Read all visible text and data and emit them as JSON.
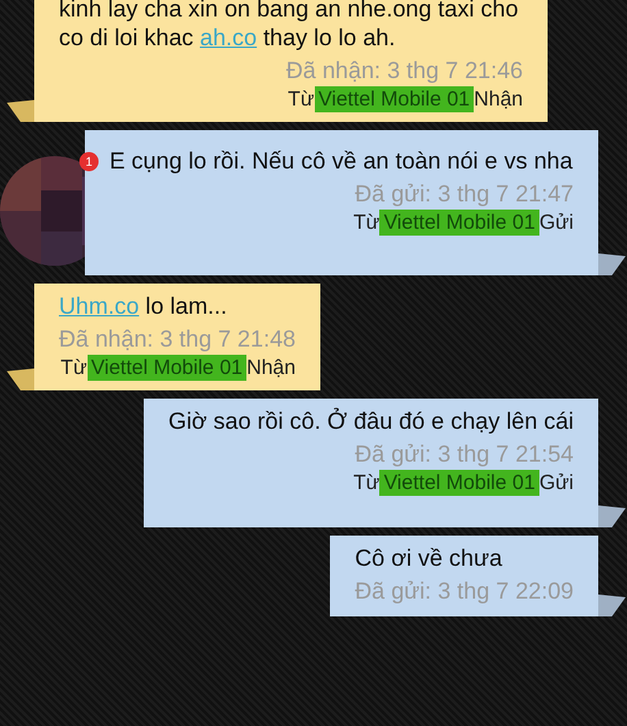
{
  "messages": [
    {
      "kind": "received",
      "parts": [
        {
          "kind": "text",
          "text": "kinh lay cha xin on bang an nhe.ong taxi cho co di loi khac "
        },
        {
          "kind": "link",
          "text": "ah.co"
        },
        {
          "kind": "text",
          "text": " thay lo lo ah."
        }
      ],
      "status": "Đã nhận: 3 thg 7 21:46",
      "from": {
        "prefix": "Từ",
        "sim": "Viettel Mobile 01",
        "direction": "Nhận"
      }
    },
    {
      "kind": "sent",
      "avatar": {
        "badge": "1"
      },
      "parts": [
        {
          "kind": "text",
          "text": "E cụng lo rồi. Nếu cô về an toàn nói e vs nha"
        }
      ],
      "status": "Đã gửi: 3 thg 7 21:47",
      "from": {
        "prefix": "Từ",
        "sim": "Viettel Mobile 01",
        "direction": "Gửi"
      }
    },
    {
      "kind": "received",
      "parts": [
        {
          "kind": "link",
          "text": "Uhm.co"
        },
        {
          "kind": "text",
          "text": " lo lam..."
        }
      ],
      "status": "Đã nhận: 3 thg 7 21:48",
      "from": {
        "prefix": "Từ",
        "sim": "Viettel Mobile 01",
        "direction": "Nhận"
      }
    },
    {
      "kind": "sent",
      "parts": [
        {
          "kind": "text",
          "text": "Giờ sao rồi cô. Ở đâu đó e chạy lên cái"
        }
      ],
      "status": "Đã gửi: 3 thg 7 21:54",
      "from": {
        "prefix": "Từ",
        "sim": "Viettel Mobile 01",
        "direction": "Gửi"
      }
    },
    {
      "kind": "sent",
      "parts": [
        {
          "kind": "text",
          "text": "Cô ơi về chưa"
        }
      ],
      "status": "Đã gửi: 3 thg 7 22:09"
    }
  ]
}
